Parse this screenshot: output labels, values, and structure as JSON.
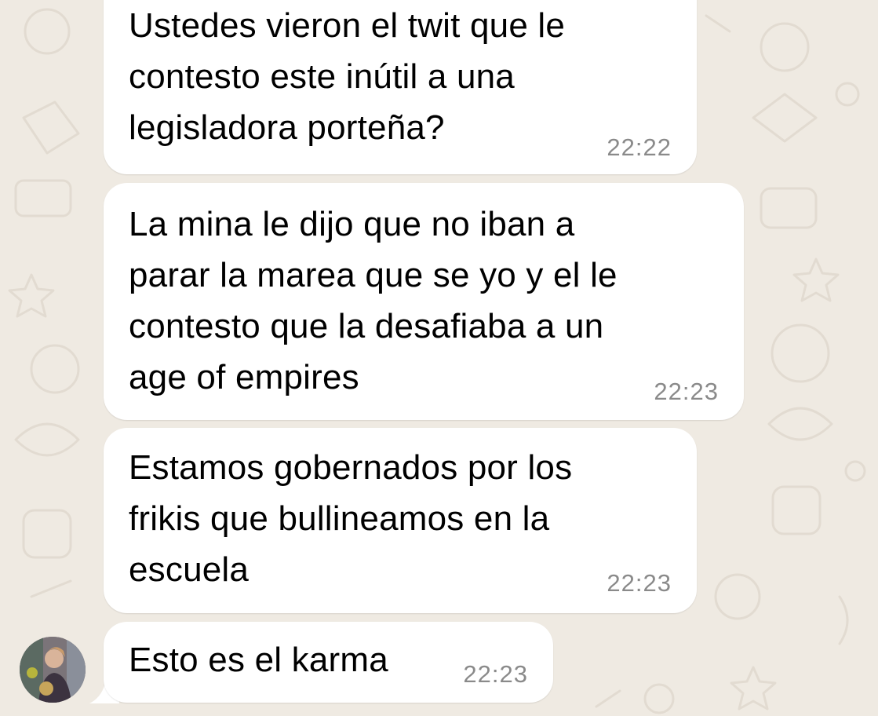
{
  "chat": {
    "messages": [
      {
        "text": "Ustedes vieron el twit que le\ncontesto este inútil a una\nlegisladora porteña?",
        "time": "22:22"
      },
      {
        "text": "La mina le dijo que no iban a\nparar la marea que se yo y el le\ncontesto que la desafiaba a un\nage of empires",
        "time": "22:23"
      },
      {
        "text": "Estamos gobernados por los\nfrikis que bullineamos en la\nescuela",
        "time": "22:23"
      },
      {
        "text": "Esto es el karma",
        "time": "22:23"
      }
    ]
  },
  "colors": {
    "background": "#efeae2",
    "bubble": "#ffffff",
    "timestamp": "#8a8a8a",
    "text": "#000000"
  },
  "icons": {
    "avatar": "sender-avatar-photo",
    "wallpaper": "doodle-pattern"
  }
}
